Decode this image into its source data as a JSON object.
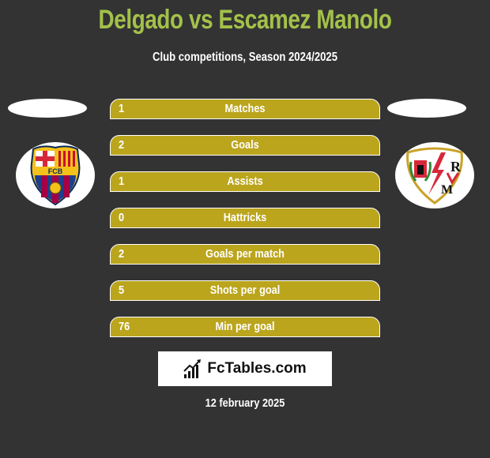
{
  "header": {
    "title": "Delgado vs Escamez Manolo",
    "subtitle": "Club competitions, Season 2024/2025"
  },
  "teams": {
    "left": {
      "name": "FC Barcelona",
      "logo_icon": "fc-barcelona-crest-icon",
      "logo_text": "FCB"
    },
    "right": {
      "name": "Rayo Vallecano",
      "logo_icon": "rayo-vallecano-crest-icon",
      "logo_text": "RVM"
    }
  },
  "colors": {
    "background": "#333333",
    "title": "#a3c14a",
    "bar": "#bba51d"
  },
  "stats": [
    {
      "value": "1",
      "label": "Matches"
    },
    {
      "value": "2",
      "label": "Goals"
    },
    {
      "value": "1",
      "label": "Assists"
    },
    {
      "value": "0",
      "label": "Hattricks"
    },
    {
      "value": "2",
      "label": "Goals per match"
    },
    {
      "value": "5",
      "label": "Shots per goal"
    },
    {
      "value": "76",
      "label": "Min per goal"
    }
  ],
  "footer": {
    "brand": "FcTables.com",
    "brand_icon": "bar-chart-icon",
    "date": "12 february 2025"
  }
}
